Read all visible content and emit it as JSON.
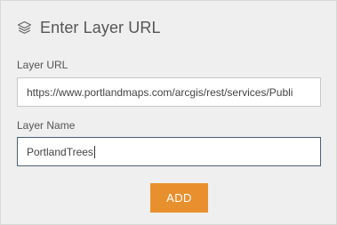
{
  "header": {
    "title": "Enter Layer URL",
    "icon": "layers-icon"
  },
  "form": {
    "url_label": "Layer URL",
    "url_value": "https://www.portlandmaps.com/arcgis/rest/services/Publi",
    "name_label": "Layer Name",
    "name_value": "PortlandTrees"
  },
  "actions": {
    "add_label": "ADD"
  },
  "colors": {
    "panel_background": "#efefef",
    "accent_button": "#e8902e",
    "focused_border": "#4a5f78"
  }
}
